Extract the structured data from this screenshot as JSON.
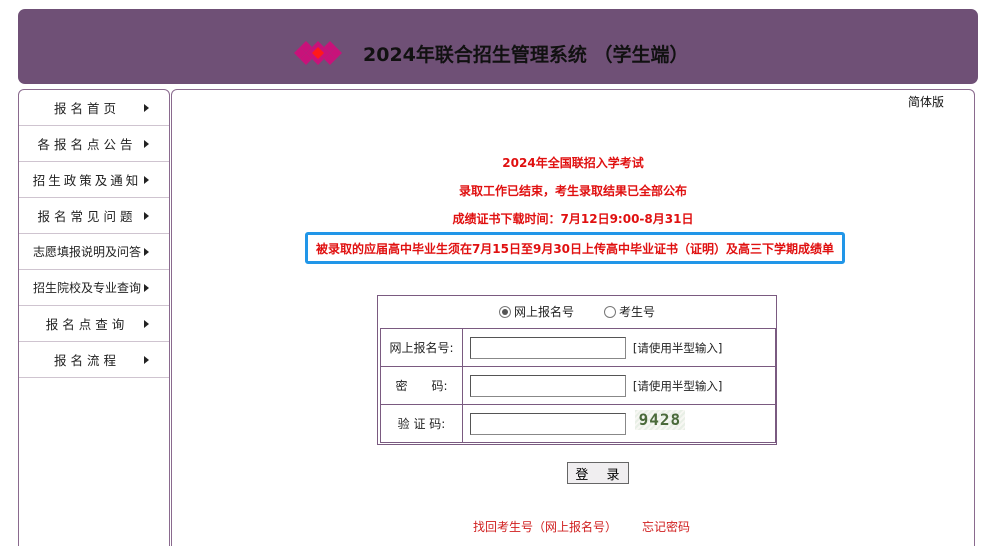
{
  "header": {
    "title": "2024年联合招生管理系统 （学生端）"
  },
  "sidebar": {
    "items": [
      {
        "label": "报名首页"
      },
      {
        "label": "各报名点公告"
      },
      {
        "label": "招生政策及通知"
      },
      {
        "label": "报名常见问题"
      },
      {
        "label": "志愿填报说明及问答"
      },
      {
        "label": "招生院校及专业查询"
      },
      {
        "label": "报名点查询"
      },
      {
        "label": "报名流程"
      }
    ]
  },
  "main": {
    "lang_link": "简体版",
    "notices": [
      "2024年全国联招入学考试",
      "录取工作已结束，考生录取结果已全部公布",
      "成绩证书下载时间：7月12日9:00-8月31日"
    ],
    "highlight_notice": "被录取的应届高中毕业生须在7月15日至9月30日上传高中毕业证书（证明）及高三下学期成绩单"
  },
  "login": {
    "radio_options": [
      {
        "label": "网上报名号",
        "checked": true
      },
      {
        "label": "考生号",
        "checked": false
      }
    ],
    "fields": [
      {
        "label": "网上报名号:",
        "value": "",
        "hint": "[请使用半型输入]"
      },
      {
        "label": "密　　码:",
        "value": "",
        "hint": "[请使用半型输入]"
      },
      {
        "label": "验 证 码:",
        "value": "",
        "captcha": "9428"
      }
    ],
    "submit_label": "登 录",
    "recover_link": "找回考生号（网上报名号）",
    "forgot_link": "忘记密码"
  },
  "colors": {
    "header_bg": "#6f5076",
    "notice_red": "#e01010",
    "notice_box_border": "#2196e8",
    "logo_magenta": "#c8127a",
    "logo_red": "#ff1a1a"
  },
  "icons": [
    "diamond-logo-icon",
    "chevron-right-icon",
    "radio-icon",
    "captcha-image"
  ]
}
